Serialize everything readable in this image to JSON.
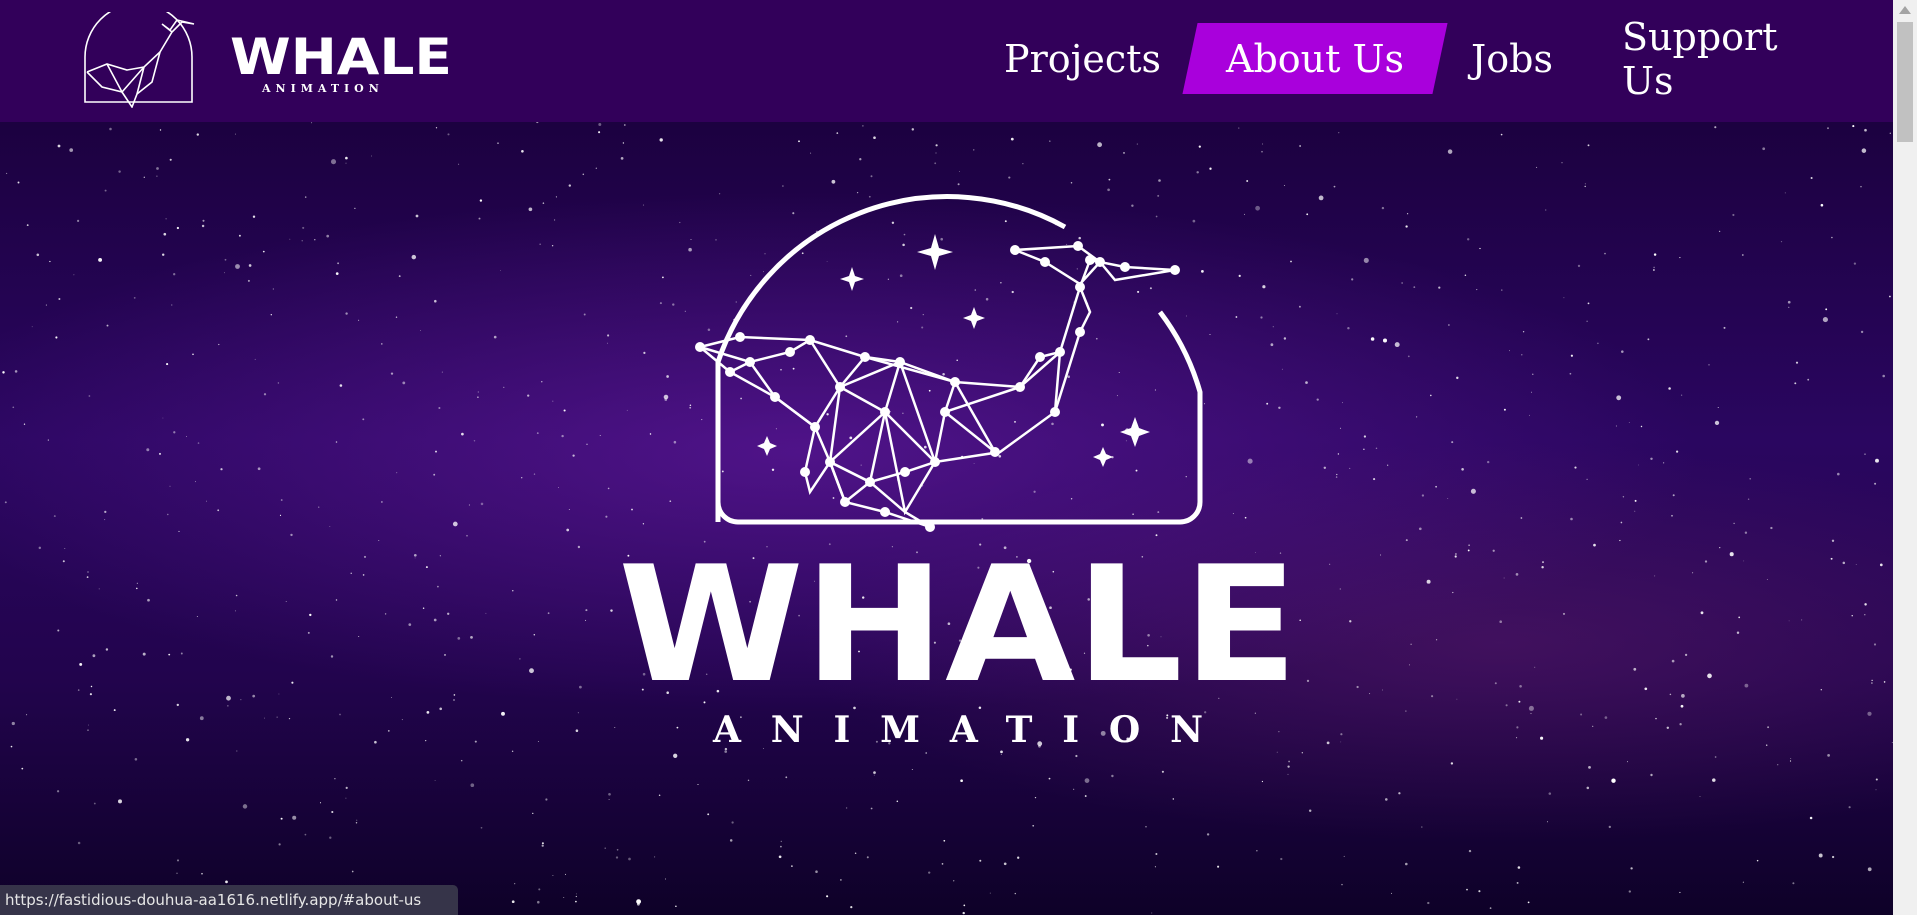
{
  "brand": {
    "name": "WHALE",
    "tagline": "ANIMATION"
  },
  "nav": {
    "items": [
      {
        "label": "Projects",
        "active": false
      },
      {
        "label": "About Us",
        "active": true
      },
      {
        "label": "Jobs",
        "active": false
      },
      {
        "label": "Support Us",
        "active": false
      }
    ]
  },
  "colors": {
    "header": "#32005a",
    "active_tab": "#a900dc",
    "text": "#ffffff"
  },
  "status_bar": {
    "url": "https://fastidious-douhua-aa1616.netlify.app/#about-us"
  }
}
